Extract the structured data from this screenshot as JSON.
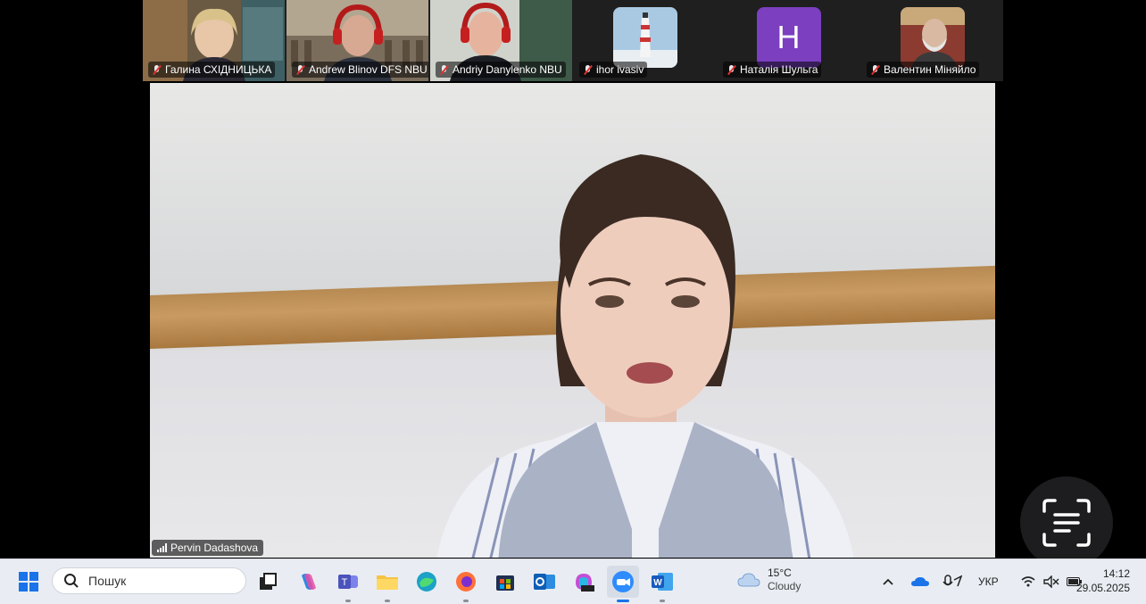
{
  "participants": [
    {
      "name": "Галина СХІДНИЦЬКА",
      "muted": true,
      "kind": "video"
    },
    {
      "name": "Andrew Blinov DFS NBU",
      "muted": true,
      "kind": "video"
    },
    {
      "name": "Andriy Danylenko NBU",
      "muted": true,
      "kind": "video"
    },
    {
      "name": "ihor ivasiv",
      "muted": true,
      "kind": "image"
    },
    {
      "name": "Наталія Шульга",
      "muted": true,
      "kind": "initial",
      "initial": "H"
    },
    {
      "name": "Валентин Міняйло",
      "muted": true,
      "kind": "video"
    }
  ],
  "main_speaker": {
    "name": "Pervin Dadashova"
  },
  "taskbar": {
    "search_placeholder": "Пошук",
    "apps": [
      "windows-start-icon",
      "task-view-icon",
      "copilot-icon",
      "teams-icon",
      "file-explorer-icon",
      "edge-icon",
      "firefox-icon",
      "store-icon",
      "outlook-icon",
      "m365-icon",
      "zoom-icon",
      "word-icon"
    ],
    "weather": {
      "temp": "15°C",
      "condition": "Cloudy"
    },
    "language": "УКР",
    "time": "14:12",
    "date": "29.05.2025"
  },
  "colors": {
    "accent": "#1a73e8",
    "muted_red": "#e03131",
    "taskbar_bg": "#e9edf3"
  }
}
